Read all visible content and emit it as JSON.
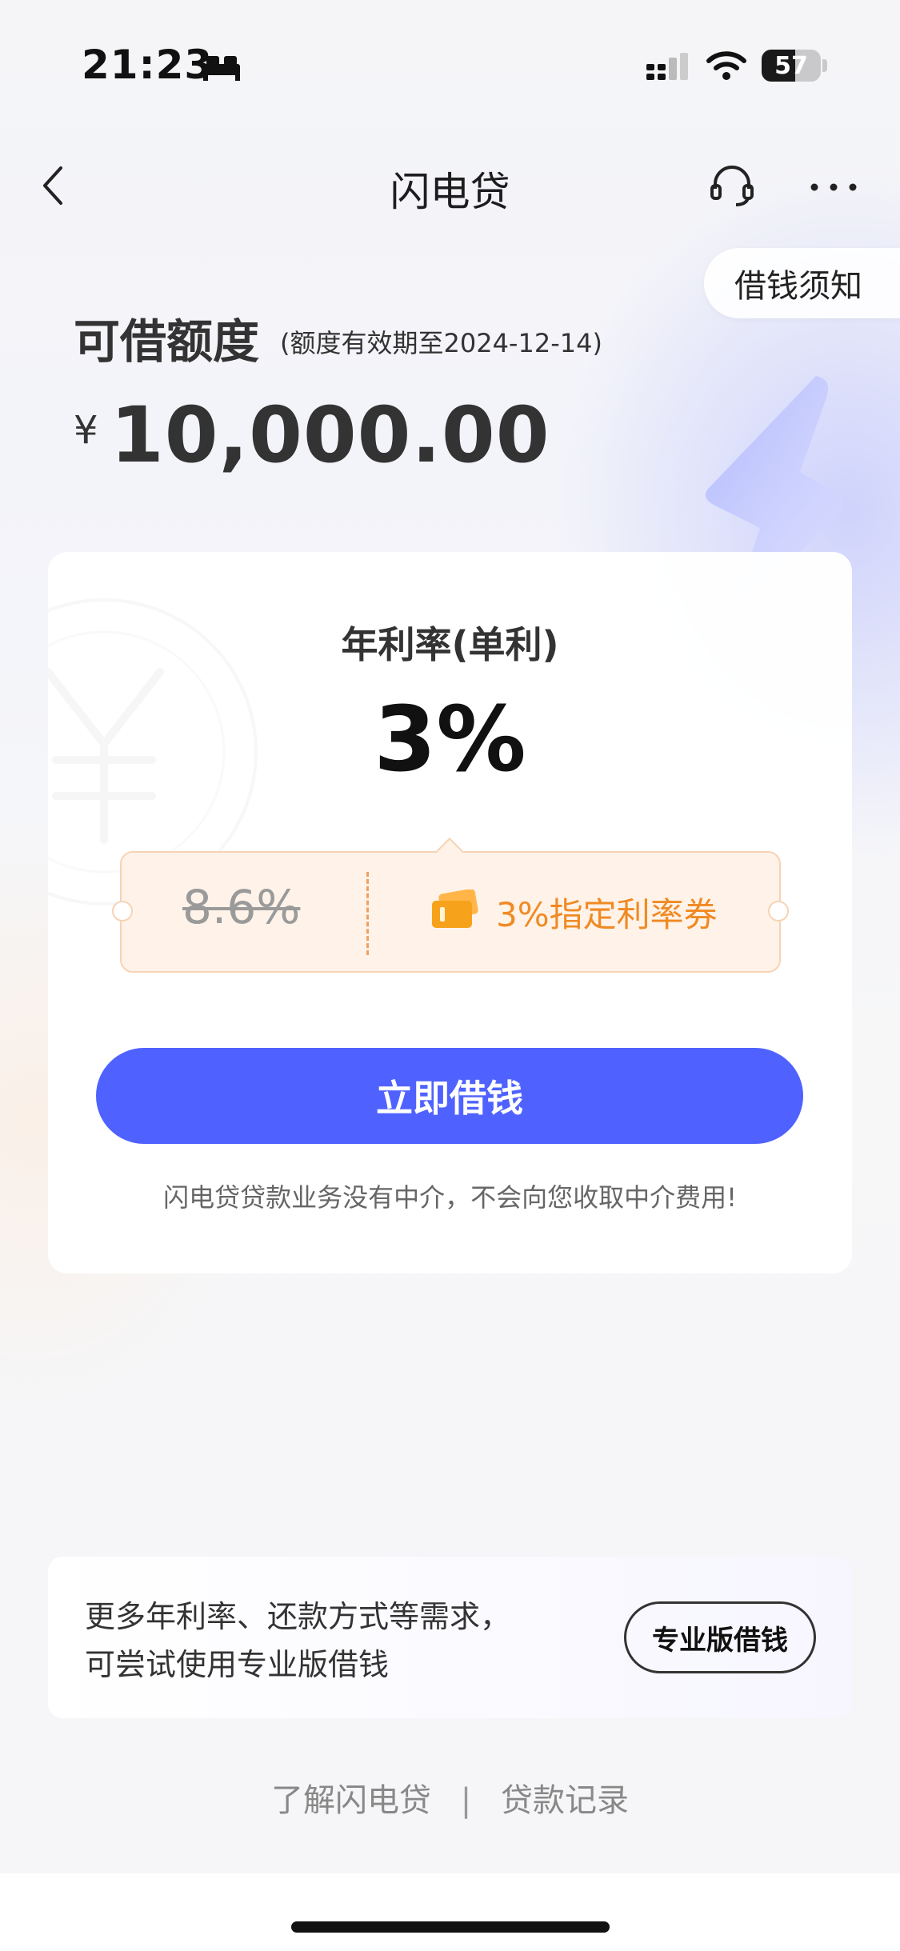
{
  "status_bar": {
    "time": "21:23",
    "battery": "57",
    "battery_level": 0.57
  },
  "nav": {
    "title": "闪电贷",
    "icons": [
      "back-icon",
      "headset-icon",
      "more-icon"
    ]
  },
  "notice": {
    "label": "借钱须知"
  },
  "credit": {
    "label": "可借额度",
    "validity": "(额度有效期至2024-12-14)",
    "currency": "¥",
    "amount": "10,000.00"
  },
  "rate": {
    "label": "年利率(单利)",
    "value": "3%",
    "original": "8.6%",
    "coupon_text": "3%指定利率券"
  },
  "actions": {
    "borrow_label": "立即借钱"
  },
  "disclaimer": "闪电贷贷款业务没有中介，不会向您收取中介费用!",
  "pro": {
    "line1": "更多年利率、还款方式等需求，",
    "line2": "可尝试使用专业版借钱",
    "button": "专业版借钱"
  },
  "footer": {
    "link1": "了解闪电贷",
    "separator": "|",
    "link2": "贷款记录"
  },
  "colors": {
    "accent": "#4f62ff",
    "coupon_orange": "#f08a24",
    "coupon_bg": "#fff3e9"
  }
}
